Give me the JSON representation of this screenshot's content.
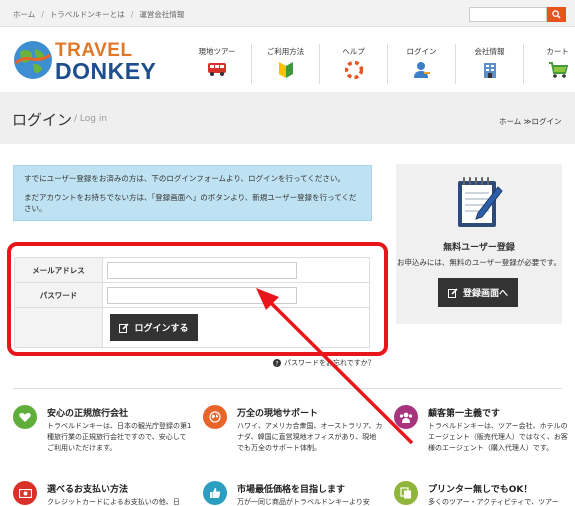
{
  "topbar": {
    "breadcrumbs": [
      "ホーム",
      "トラベルドンキーとは",
      "運営会社情報"
    ],
    "search_placeholder": ""
  },
  "logo": {
    "line1": "TRAVEL",
    "line2": "DONKEY"
  },
  "nav": [
    {
      "label": "現地ツアー",
      "icon": "bus-icon"
    },
    {
      "label": "ご利用方法",
      "icon": "beginner-mark-icon"
    },
    {
      "label": "ヘルプ",
      "icon": "lifebuoy-icon"
    },
    {
      "label": "ログイン",
      "icon": "user-key-icon"
    },
    {
      "label": "会社情報",
      "icon": "building-icon"
    },
    {
      "label": "カート",
      "icon": "cart-icon"
    }
  ],
  "page": {
    "title": "ログイン",
    "subtitle": "/ Log in",
    "breadcrumb_home": "ホーム",
    "breadcrumb_sep": "≫",
    "breadcrumb_current": "ログイン"
  },
  "notice": {
    "line1": "すでにユーザー登録をお済みの方は、下のログインフォームより、ログインを行ってください。",
    "line2": "まだアカウントをお持ちでない方は、「登録画面へ」のボタンより、新規ユーザー登録を行ってください。"
  },
  "form": {
    "email_label": "メールアドレス",
    "email_value": "",
    "password_label": "パスワード",
    "password_value": "",
    "login_button": "ログインする",
    "forgot_link": "パスワードをお忘れですか？"
  },
  "sidebar": {
    "title": "無料ユーザー登録",
    "desc": "お申込みには、無料のユーザー登録が必要です。",
    "register_button": "登録画面へ"
  },
  "features": [
    {
      "title": "安心の正規旅行会社",
      "desc": "トラベルドンキーは、日本の観光庁登録の第1種旅行業の正規旅行会社ですので、安心してご利用いただけます。",
      "icon": "heart-icon",
      "color": "#5fae3b"
    },
    {
      "title": "万全の現地サポート",
      "desc": "ハワイ、アメリカ合衆国、オーストラリア、カナダ、韓国に直営現地オフィスがあり、現地でも万全のサポート体制。",
      "icon": "globe-icon",
      "color": "#e8652a"
    },
    {
      "title": "顧客第一主義です",
      "desc": "トラベルドンキーは、ツアー会社、ホテルのエージェント（販売代理人）ではなく、お客様のエージェント（購入代理人）です。",
      "icon": "people-icon",
      "color": "#a6347e"
    },
    {
      "title": "選べるお支払い方法",
      "desc": "クレジットカードによるお支払いの他、日",
      "icon": "money-icon",
      "color": "#d9302a"
    },
    {
      "title": "市場最低価格を目指します",
      "desc": "万が一同じ商品がトラベルドンキーより安",
      "icon": "thumbs-up-icon",
      "color": "#2a9fbf"
    },
    {
      "title": "プリンター無しでもOK！",
      "desc": "多くのツアー・アクティビティで、ツアー",
      "icon": "copy-icon",
      "color": "#8fb53a"
    }
  ]
}
